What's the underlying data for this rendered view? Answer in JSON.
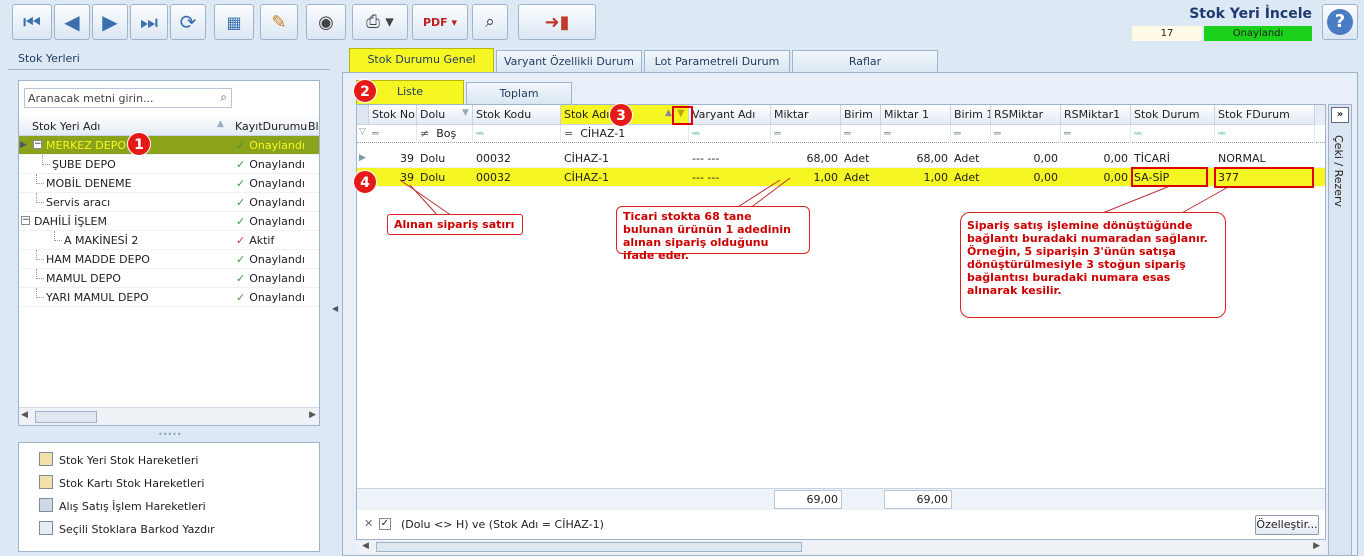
{
  "header": {
    "title": "Stok Yeri İncele",
    "record_no": "17",
    "status": "Onaylandı"
  },
  "toolbar": {
    "icons": [
      "first-icon",
      "prev-icon",
      "next-icon",
      "last-icon",
      "refresh-icon",
      "report-icon",
      "edit-icon",
      "preview-icon",
      "print-icon",
      "pdf-icon",
      "search-doc-icon",
      "exit-icon",
      "help-icon"
    ]
  },
  "left": {
    "title": "Stok Yerleri",
    "search_placeholder": "Aranacak metni girin...",
    "columns": [
      "Stok Yeri Adı",
      "KayıtDurumu",
      "Bl"
    ],
    "rows": [
      {
        "name": "MERKEZ DEPO",
        "status": "Onaylandı",
        "icon": "check"
      },
      {
        "name": "ŞUBE DEPO",
        "status": "Onaylandı",
        "icon": "check"
      },
      {
        "name": "MOBİL DENEME",
        "status": "Onaylandı",
        "icon": "check"
      },
      {
        "name": "Servis aracı",
        "status": "Onaylandı",
        "icon": "check"
      },
      {
        "name": "DAHİLİ İŞLEM",
        "status": "Onaylandı",
        "icon": "check"
      },
      {
        "name": "A MAKİNESİ 2",
        "status": "Aktif",
        "icon": "x"
      },
      {
        "name": "HAM MADDE DEPO",
        "status": "Onaylandı",
        "icon": "check"
      },
      {
        "name": "MAMUL DEPO",
        "status": "Onaylandı",
        "icon": "check"
      },
      {
        "name": "YARI MAMUL DEPO",
        "status": "Onaylandı",
        "icon": "check"
      }
    ],
    "links": [
      "Stok Yeri Stok Hareketleri",
      "Stok Kartı Stok Hareketleri",
      "Alış Satış İşlem Hareketleri",
      "Seçili Stoklara Barkod Yazdır"
    ]
  },
  "tabs": [
    "Stok Durumu Genel",
    "Varyant Özellikli Durum",
    "Lot Parametreli Durum",
    "Raflar"
  ],
  "subtabs": [
    "Liste",
    "Toplam"
  ],
  "grid": {
    "columns": [
      "Stok No",
      "Dolu",
      "Stok Kodu",
      "Stok Adı",
      "Varyant Adı",
      "Miktar",
      "Birim",
      "Miktar 1",
      "Birim 1",
      "RSMiktar",
      "RSMiktar1",
      "Stok Durum",
      "Stok FDurum"
    ],
    "filter": {
      "dolu_op": "≠",
      "dolu_val": "Boş",
      "stokadi_op": "=",
      "stokadi_val": "CİHAZ-1"
    },
    "rows": [
      [
        "39",
        "Dolu",
        "00032",
        "CİHAZ-1",
        "--- ---",
        "68,00",
        "Adet",
        "68,00",
        "Adet",
        "0,00",
        "0,00",
        "TİCARİ",
        "NORMAL"
      ],
      [
        "39",
        "Dolu",
        "00032",
        "CİHAZ-1",
        "--- ---",
        "1,00",
        "Adet",
        "1,00",
        "Adet",
        "0,00",
        "0,00",
        "SA-SİP",
        "377"
      ]
    ],
    "totals": {
      "miktar": "69,00",
      "miktar1": "69,00"
    },
    "filter_text": "(Dolu <> H) ve (Stok Adı = CİHAZ-1)",
    "customize_label": "Özelleştir...",
    "side_label": "Çeki / Rezerv"
  },
  "annotations": {
    "badges": [
      "1",
      "2",
      "3",
      "4"
    ],
    "c1": "Alınan sipariş satırı",
    "c2": "Ticari stokta 68 tane bulunan ürünün 1 adedinin alınan sipariş olduğunu ifade eder.",
    "c3": "Sipariş satış işlemine dönüştüğünde bağlantı buradaki numaradan sağlanır. Örneğin, 5 siparişin 3'ünün satışa dönüştürülmesiyle 3 stoğun sipariş bağlantısı buradaki numara esas alınarak kesilir."
  },
  "colors": {
    "accent_yellow": "#f6f622",
    "status_green": "#1bd11b",
    "annotation_red": "#e61919"
  }
}
